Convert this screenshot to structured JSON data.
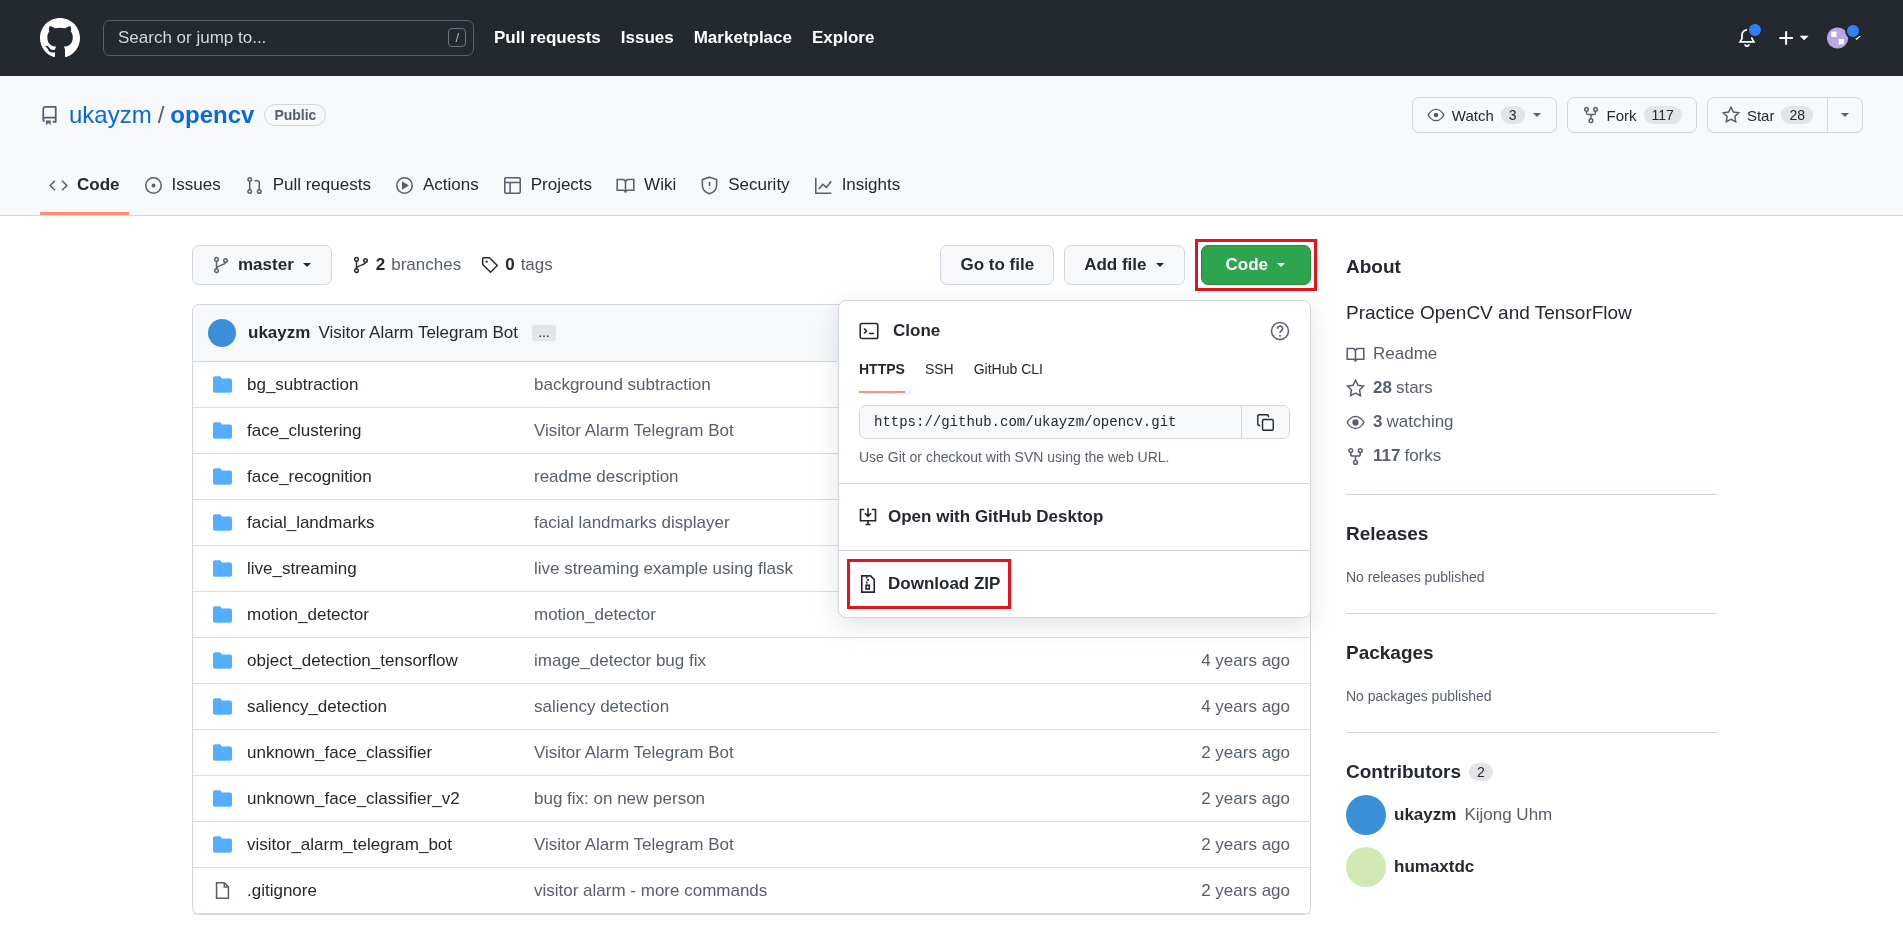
{
  "header": {
    "search_placeholder": "Search or jump to...",
    "shortcut_key": "/",
    "nav": [
      "Pull requests",
      "Issues",
      "Marketplace",
      "Explore"
    ],
    "bell_unread": true,
    "avatar_badge": true
  },
  "repo": {
    "owner": "ukayzm",
    "separator": "/",
    "name": "opencv",
    "visibility": "Public",
    "actions": [
      {
        "kind": "watch",
        "label": "Watch",
        "count": "3"
      },
      {
        "kind": "fork",
        "label": "Fork",
        "count": "117"
      },
      {
        "kind": "star",
        "label": "Star",
        "count": "28"
      }
    ]
  },
  "tabs": [
    {
      "kind": "code",
      "label": "Code",
      "selected": true
    },
    {
      "kind": "issues",
      "label": "Issues",
      "selected": false
    },
    {
      "kind": "pulls",
      "label": "Pull requests",
      "selected": false
    },
    {
      "kind": "actions",
      "label": "Actions",
      "selected": false
    },
    {
      "kind": "projects",
      "label": "Projects",
      "selected": false
    },
    {
      "kind": "wiki",
      "label": "Wiki",
      "selected": false
    },
    {
      "kind": "security",
      "label": "Security",
      "selected": false
    },
    {
      "kind": "insights",
      "label": "Insights",
      "selected": false
    }
  ],
  "toolbar": {
    "branch": "master",
    "branches_count": "2",
    "branches_label": "branches",
    "tags_count": "0",
    "tags_label": "tags",
    "go_to_file": "Go to file",
    "add_file": "Add file",
    "code_button": "Code",
    "code_highlighted": true
  },
  "commit": {
    "author": "ukayzm",
    "message": "Visitor Alarm Telegram Bot",
    "more": "…"
  },
  "files": [
    {
      "kind": "dir",
      "name": "bg_subtraction",
      "message": "background subtraction"
    },
    {
      "kind": "dir",
      "name": "face_clustering",
      "message": "Visitor Alarm Telegram Bot"
    },
    {
      "kind": "dir",
      "name": "face_recognition",
      "message": "readme description"
    },
    {
      "kind": "dir",
      "name": "facial_landmarks",
      "message": "facial landmarks displayer"
    },
    {
      "kind": "dir",
      "name": "live_streaming",
      "message": "live streaming example using flask"
    },
    {
      "kind": "dir",
      "name": "motion_detector",
      "message": "motion_detector"
    },
    {
      "kind": "dir",
      "name": "object_detection_tensorflow",
      "message": "image_detector bug fix",
      "time": "4 years ago"
    },
    {
      "kind": "dir",
      "name": "saliency_detection",
      "message": "saliency detection",
      "time": "4 years ago"
    },
    {
      "kind": "dir",
      "name": "unknown_face_classifier",
      "message": "Visitor Alarm Telegram Bot",
      "time": "2 years ago"
    },
    {
      "kind": "dir",
      "name": "unknown_face_classifier_v2",
      "message": "bug fix: on new person",
      "time": "2 years ago"
    },
    {
      "kind": "dir",
      "name": "visitor_alarm_telegram_bot",
      "message": "Visitor Alarm Telegram Bot",
      "time": "2 years ago"
    },
    {
      "kind": "file",
      "name": ".gitignore",
      "message": "visitor alarm - more commands",
      "time": "2 years ago"
    }
  ],
  "clone_popover": {
    "title": "Clone",
    "tabs": [
      {
        "label": "HTTPS",
        "selected": true
      },
      {
        "label": "SSH",
        "selected": false
      },
      {
        "label": "GitHub CLI",
        "selected": false
      }
    ],
    "url": "https://github.com/ukayzm/opencv.git",
    "hint": "Use Git or checkout with SVN using the web URL.",
    "actions": [
      {
        "kind": "desktop",
        "label": "Open with GitHub Desktop",
        "highlighted": false
      },
      {
        "kind": "zip",
        "label": "Download ZIP",
        "highlighted": true
      }
    ]
  },
  "about": {
    "title": "About",
    "description": "Practice OpenCV and TensorFlow",
    "stats": [
      {
        "kind": "readme",
        "label": "Readme"
      },
      {
        "kind": "star",
        "value": "28",
        "label": "stars"
      },
      {
        "kind": "watch",
        "value": "3",
        "label": "watching"
      },
      {
        "kind": "fork",
        "value": "117",
        "label": "forks"
      }
    ]
  },
  "releases": {
    "title": "Releases",
    "note": "No releases published"
  },
  "packages": {
    "title": "Packages",
    "note": "No packages published"
  },
  "contributors": {
    "title": "Contributors",
    "count": "2",
    "people": [
      {
        "login": "ukayzm",
        "name": "Kijong Uhm",
        "color": "#3a8fd6"
      },
      {
        "login": "humaxtdc",
        "color": "#cfe8b4"
      }
    ]
  }
}
